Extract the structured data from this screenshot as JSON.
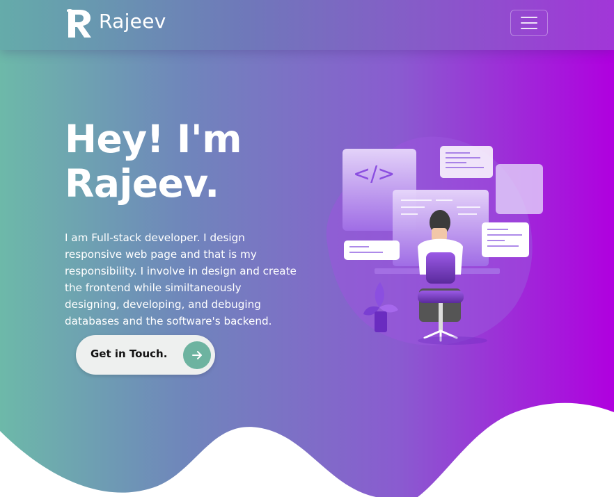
{
  "navbar": {
    "brand": "Rajeev",
    "logo_icon": "r-monogram-icon",
    "menu_icon": "hamburger-menu-icon"
  },
  "hero": {
    "headline_line1": "Hey! I'm",
    "headline_line2": "Rajeev.",
    "intro": "I am Full-stack developer. I design responsive web page and that is my responsibility. I involve in design and create the frontend while similtaneously designing, developing, and debuging databases and the software's backend.",
    "cta_label": "Get in Touch.",
    "cta_icon": "arrow-right-icon",
    "illustration_code_tag": "</>"
  },
  "colors": {
    "gradient_start": "#6db9a9",
    "gradient_mid": "#8a5bd0",
    "gradient_end": "#b000df",
    "cta_background": "#eef0ef",
    "cta_arrow": "#6db3a0"
  }
}
